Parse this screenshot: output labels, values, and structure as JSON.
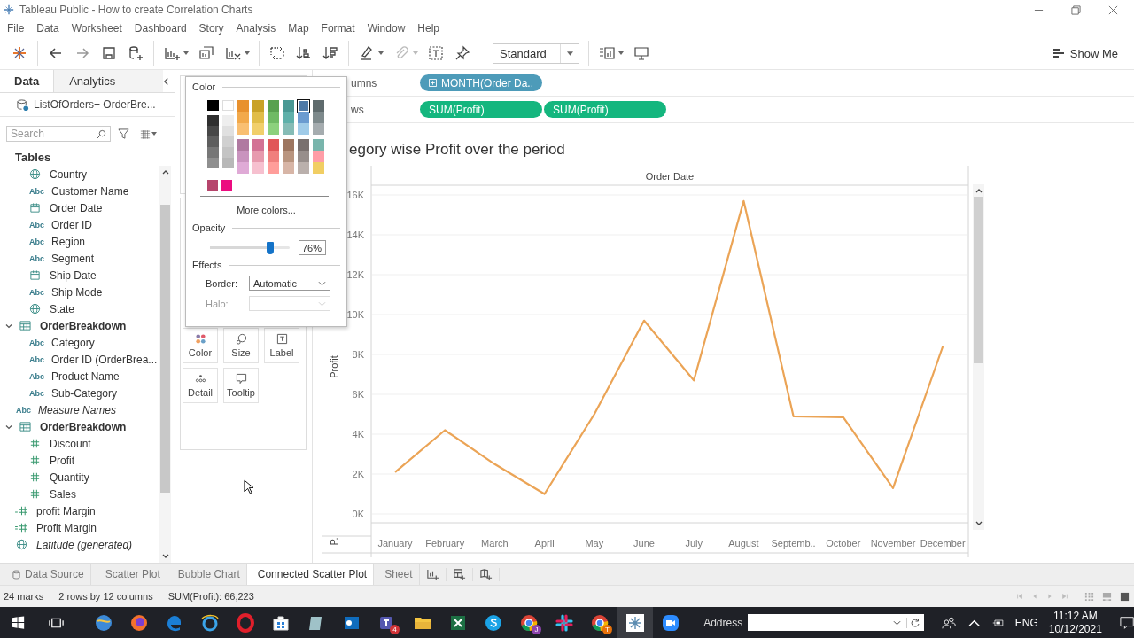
{
  "window": {
    "title": "Tableau Public - How to create Correlation Charts"
  },
  "menu": [
    "File",
    "Data",
    "Worksheet",
    "Dashboard",
    "Story",
    "Analysis",
    "Map",
    "Format",
    "Window",
    "Help"
  ],
  "toolbar": {
    "fit_mode": "Standard",
    "show_me": "Show Me"
  },
  "data_pane": {
    "tabs": [
      {
        "label": "Data",
        "selected": true
      },
      {
        "label": "Analytics",
        "selected": false
      }
    ],
    "datasource": "ListOfOrders+ OrderBre...",
    "search": {
      "placeholder": "Search"
    },
    "tables_heading": "Tables",
    "fields": [
      {
        "children": [
          {
            "name": "Country",
            "kind": "geo"
          },
          {
            "name": "Customer Name",
            "kind": "abc",
            "badge": "Abc"
          },
          {
            "name": "Order Date",
            "kind": "date"
          },
          {
            "name": "Order ID",
            "kind": "abc",
            "badge": "Abc"
          },
          {
            "name": "Region",
            "kind": "abc",
            "badge": "Abc"
          },
          {
            "name": "Segment",
            "kind": "abc",
            "badge": "Abc"
          },
          {
            "name": "Ship Date",
            "kind": "date"
          },
          {
            "name": "Ship Mode",
            "kind": "abc",
            "badge": "Abc"
          },
          {
            "name": "State",
            "kind": "geo"
          }
        ]
      },
      {
        "name": "OrderBreakdown",
        "expanded": true,
        "children": [
          {
            "name": "Category",
            "kind": "abc",
            "badge": "Abc"
          },
          {
            "name": "Order ID (OrderBrea...",
            "kind": "abc",
            "badge": "Abc"
          },
          {
            "name": "Product Name",
            "kind": "abc",
            "badge": "Abc"
          },
          {
            "name": "Sub-Category",
            "kind": "abc",
            "badge": "Abc"
          }
        ]
      },
      {
        "name": "Measure Names",
        "kind": "abc",
        "badge": "Abc",
        "italic": true
      },
      {
        "name": "OrderBreakdown",
        "expanded": true,
        "children": [
          {
            "name": "Discount",
            "kind": "number"
          },
          {
            "name": "Profit",
            "kind": "number"
          },
          {
            "name": "Quantity",
            "kind": "number"
          },
          {
            "name": "Sales",
            "kind": "number"
          }
        ]
      },
      {
        "name": "profit Margin",
        "kind": "calc"
      },
      {
        "name": "Profit Margin",
        "kind": "calc"
      },
      {
        "name": "Latitude (generated)",
        "kind": "geo",
        "italic": true
      }
    ]
  },
  "color_popup": {
    "heading": "Color",
    "palette": [
      {
        "upper": [
          {
            "color": "#000000",
            "selected": false
          }
        ],
        "lower": [
          {
            "color": "#2f2f2f",
            "selected": false
          },
          {
            "color": "#474747",
            "selected": false
          },
          {
            "color": "#5e5e5e",
            "selected": false
          },
          {
            "color": "#777777",
            "selected": false
          },
          {
            "color": "#8f8f8f",
            "selected": false
          }
        ]
      },
      {
        "upper": [
          {
            "color": "#ffffff",
            "selected": false
          }
        ],
        "lower": [
          {
            "color": "#eeeeee",
            "selected": false
          },
          {
            "color": "#e0e0e0",
            "selected": false
          },
          {
            "color": "#d0d0d0",
            "selected": false
          },
          {
            "color": "#c4c4c4",
            "selected": false
          },
          {
            "color": "#b8b8b8",
            "selected": false
          }
        ]
      },
      {
        "upper": [
          {
            "color": "#e8912e",
            "selected": false
          },
          {
            "color": "#f2a94b",
            "selected": false
          },
          {
            "color": "#f9bf72",
            "selected": false
          }
        ],
        "lower": [
          {
            "color": "#b07aa1",
            "selected": false
          },
          {
            "color": "#c993be",
            "selected": false
          },
          {
            "color": "#dfaad6",
            "selected": false
          }
        ]
      },
      {
        "upper": [
          {
            "color": "#c9a227",
            "selected": false
          },
          {
            "color": "#e1bd48",
            "selected": false
          },
          {
            "color": "#f1cf6b",
            "selected": false
          }
        ],
        "lower": [
          {
            "color": "#d37295",
            "selected": false
          },
          {
            "color": "#e79aae",
            "selected": false
          },
          {
            "color": "#f6c0cf",
            "selected": false
          }
        ]
      },
      {
        "upper": [
          {
            "color": "#59a14f",
            "selected": false
          },
          {
            "color": "#6fba64",
            "selected": false
          },
          {
            "color": "#8cd17d",
            "selected": false
          }
        ],
        "lower": [
          {
            "color": "#e15759",
            "selected": false
          },
          {
            "color": "#f07f7d",
            "selected": false
          },
          {
            "color": "#ff9d9a",
            "selected": false
          }
        ]
      },
      {
        "upper": [
          {
            "color": "#499894",
            "selected": false
          },
          {
            "color": "#5fb0aa",
            "selected": false
          },
          {
            "color": "#86bcb6",
            "selected": false
          }
        ],
        "lower": [
          {
            "color": "#9d7660",
            "selected": false
          },
          {
            "color": "#b9957f",
            "selected": false
          },
          {
            "color": "#d7b5a6",
            "selected": false
          }
        ]
      },
      {
        "upper": [
          {
            "color": "#4e79a7",
            "selected": true
          },
          {
            "color": "#6b9bd0",
            "selected": false
          },
          {
            "color": "#a0cbe8",
            "selected": false
          }
        ],
        "lower": [
          {
            "color": "#79706e",
            "selected": false
          },
          {
            "color": "#978e8b",
            "selected": false
          },
          {
            "color": "#bab0ac",
            "selected": false
          }
        ]
      },
      {
        "upper": [
          {
            "color": "#5f6b6d",
            "selected": false
          },
          {
            "color": "#7e8a8c",
            "selected": false
          },
          {
            "color": "#a5acaf",
            "selected": false
          }
        ],
        "lower": [
          {
            "color": "#79b5ac",
            "selected": false
          },
          {
            "color": "#ff9da7",
            "selected": false
          },
          {
            "color": "#f1ce63",
            "selected": false
          }
        ]
      }
    ],
    "extra": [
      {
        "color": "#b6456c",
        "selected": false
      },
      {
        "color": "#ec0c80",
        "selected": false
      }
    ],
    "more_colors": "More colors...",
    "opacity_heading": "Opacity",
    "opacity": {
      "level": 0.76,
      "reading": "76%"
    },
    "effects_heading": "Effects",
    "border": {
      "label": "Border:",
      "value": "Automatic"
    },
    "halo": {
      "label": "Halo:",
      "disabled": true
    }
  },
  "marks_card": {
    "buttons": [
      {
        "label": "Color",
        "kind": "color"
      },
      {
        "label": "Size",
        "kind": "size"
      },
      {
        "label": "Label",
        "kind": "label"
      },
      {
        "label": "Detail",
        "kind": "detail"
      },
      {
        "label": "Tooltip",
        "kind": "tooltip"
      }
    ]
  },
  "shelves": [
    {
      "label": "umns",
      "pills": [
        {
          "text": "MONTH(Order Da..",
          "kind": "discrete",
          "expandable": true
        }
      ]
    },
    {
      "label": "ws",
      "pills": [
        {
          "text": "SUM(Profit)",
          "kind": "continuous",
          "expandable": false
        },
        {
          "text": "SUM(Profit)",
          "kind": "continuous",
          "expandable": false
        }
      ]
    }
  ],
  "sheet": {
    "title": "egory wise Profit over the period",
    "axis_stub": "P.",
    "chart_data": {
      "type": "line",
      "xlabel": "Order Date",
      "ylabel": "Profit",
      "grid": true,
      "categories": [
        "January",
        "February",
        "March",
        "April",
        "May",
        "June",
        "July",
        "August",
        "Septemb..",
        "October",
        "November",
        "December"
      ],
      "series": [
        {
          "color": "#eba456",
          "values": [
            2100,
            4200,
            2500,
            1000,
            5000,
            9700,
            6700,
            15700,
            4900,
            4850,
            1300,
            8400
          ]
        }
      ],
      "ylim": [
        0,
        16400
      ],
      "yticks": [
        {
          "value": 0,
          "label": "0K"
        },
        {
          "value": 2000,
          "label": "2K"
        },
        {
          "value": 4000,
          "label": "4K"
        },
        {
          "value": 6000,
          "label": "6K"
        },
        {
          "value": 8000,
          "label": "8K"
        },
        {
          "value": 10000,
          "label": "10K"
        },
        {
          "value": 12000,
          "label": "12K"
        },
        {
          "value": 14000,
          "label": "14K"
        },
        {
          "value": 16000,
          "label": "16K"
        }
      ]
    }
  },
  "sheet_tabs": [
    {
      "label": "Data Source",
      "kind": "datasource",
      "selected": false
    },
    {
      "label": "Scatter Plot",
      "kind": "sheet",
      "selected": false
    },
    {
      "label": "Bubble Chart",
      "kind": "sheet",
      "selected": false
    },
    {
      "label": "Connected Scatter Plot",
      "kind": "sheet",
      "selected": true
    },
    {
      "label": "Sheet",
      "kind": "sheet",
      "selected": false
    }
  ],
  "status_bar": [
    "24 marks",
    "2 rows by 12 columns",
    "SUM(Profit): 66,223"
  ],
  "taskbar": {
    "badges": [
      "4",
      "J",
      "T"
    ],
    "address_label": "Address",
    "language": "ENG",
    "time": "11:12 AM",
    "date": "10/12/2021"
  }
}
